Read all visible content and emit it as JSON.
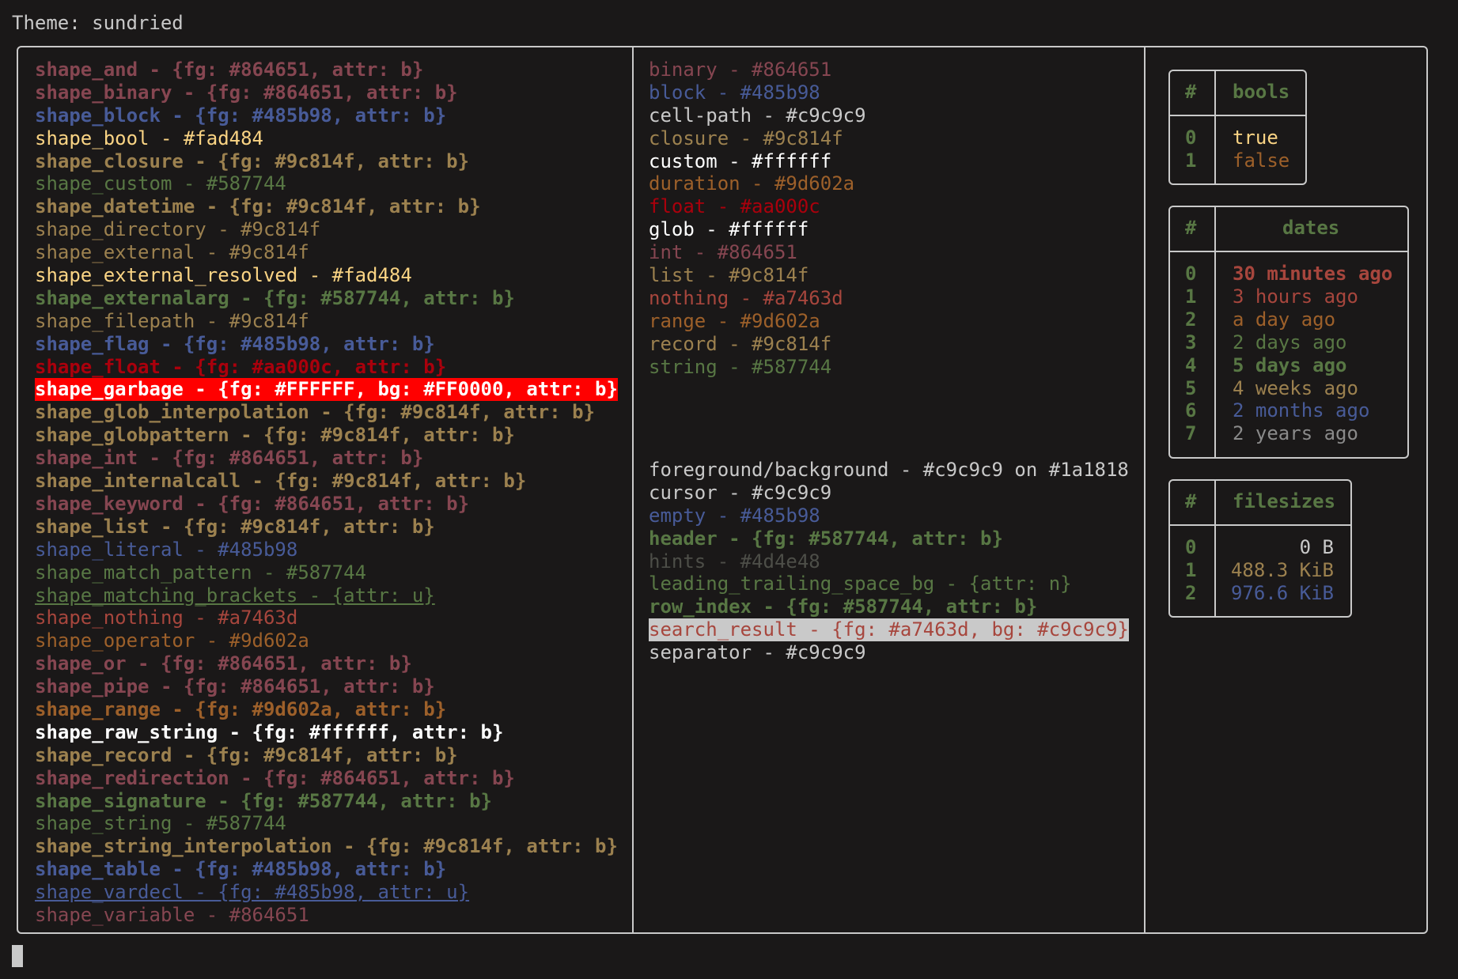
{
  "title": "Theme: sundried",
  "theme_name": "sundried",
  "colors": {
    "background": "#1a1818",
    "foreground": "#c9c9c9",
    "border": "#c9c9c9"
  },
  "shapes": [
    {
      "text": "shape_and - {fg: #864651, attr: b}",
      "fg": "#864651",
      "bold": true
    },
    {
      "text": "shape_binary - {fg: #864651, attr: b}",
      "fg": "#864651",
      "bold": true
    },
    {
      "text": "shape_block - {fg: #485b98, attr: b}",
      "fg": "#485b98",
      "bold": true
    },
    {
      "text": "shape_bool - #fad484",
      "fg": "#fad484"
    },
    {
      "text": "shape_closure - {fg: #9c814f, attr: b}",
      "fg": "#9c814f",
      "bold": true
    },
    {
      "text": "shape_custom - #587744",
      "fg": "#587744"
    },
    {
      "text": "shape_datetime - {fg: #9c814f, attr: b}",
      "fg": "#9c814f",
      "bold": true
    },
    {
      "text": "shape_directory - #9c814f",
      "fg": "#9c814f"
    },
    {
      "text": "shape_external - #9c814f",
      "fg": "#9c814f"
    },
    {
      "text": "shape_external_resolved - #fad484",
      "fg": "#fad484"
    },
    {
      "text": "shape_externalarg - {fg: #587744, attr: b}",
      "fg": "#587744",
      "bold": true
    },
    {
      "text": "shape_filepath - #9c814f",
      "fg": "#9c814f"
    },
    {
      "text": "shape_flag - {fg: #485b98, attr: b}",
      "fg": "#485b98",
      "bold": true
    },
    {
      "text": "shape_float - {fg: #aa000c, attr: b}",
      "fg": "#aa000c",
      "bold": true
    },
    {
      "text": "shape_garbage - {fg: #FFFFFF, bg: #FF0000, attr: b}",
      "fg": "#FFFFFF",
      "bg": "#FF0000",
      "bold": true
    },
    {
      "text": "shape_glob_interpolation - {fg: #9c814f, attr: b}",
      "fg": "#9c814f",
      "bold": true
    },
    {
      "text": "shape_globpattern - {fg: #9c814f, attr: b}",
      "fg": "#9c814f",
      "bold": true
    },
    {
      "text": "shape_int - {fg: #864651, attr: b}",
      "fg": "#864651",
      "bold": true
    },
    {
      "text": "shape_internalcall - {fg: #9c814f, attr: b}",
      "fg": "#9c814f",
      "bold": true
    },
    {
      "text": "shape_keyword - {fg: #864651, attr: b}",
      "fg": "#864651",
      "bold": true
    },
    {
      "text": "shape_list - {fg: #9c814f, attr: b}",
      "fg": "#9c814f",
      "bold": true
    },
    {
      "text": "shape_literal - #485b98",
      "fg": "#485b98"
    },
    {
      "text": "shape_match_pattern - #587744",
      "fg": "#587744"
    },
    {
      "text": "shape_matching_brackets - {attr: u}",
      "fg": "#587744",
      "underline": true
    },
    {
      "text": "shape_nothing - #a7463d",
      "fg": "#a7463d"
    },
    {
      "text": "shape_operator - #9d602a",
      "fg": "#9d602a"
    },
    {
      "text": "shape_or - {fg: #864651, attr: b}",
      "fg": "#864651",
      "bold": true
    },
    {
      "text": "shape_pipe - {fg: #864651, attr: b}",
      "fg": "#864651",
      "bold": true
    },
    {
      "text": "shape_range - {fg: #9d602a, attr: b}",
      "fg": "#9d602a",
      "bold": true
    },
    {
      "text": "shape_raw_string - {fg: #ffffff, attr: b}",
      "fg": "#ffffff",
      "bold": true
    },
    {
      "text": "shape_record - {fg: #9c814f, attr: b}",
      "fg": "#9c814f",
      "bold": true
    },
    {
      "text": "shape_redirection - {fg: #864651, attr: b}",
      "fg": "#864651",
      "bold": true
    },
    {
      "text": "shape_signature - {fg: #587744, attr: b}",
      "fg": "#587744",
      "bold": true
    },
    {
      "text": "shape_string - #587744",
      "fg": "#587744"
    },
    {
      "text": "shape_string_interpolation - {fg: #9c814f, attr: b}",
      "fg": "#9c814f",
      "bold": true
    },
    {
      "text": "shape_table - {fg: #485b98, attr: b}",
      "fg": "#485b98",
      "bold": true
    },
    {
      "text": "shape_vardecl - {fg: #485b98, attr: u}",
      "fg": "#485b98",
      "underline": true
    },
    {
      "text": "shape_variable - #864651",
      "fg": "#864651"
    }
  ],
  "types": [
    {
      "text": "binary - #864651",
      "fg": "#864651"
    },
    {
      "text": "block - #485b98",
      "fg": "#485b98"
    },
    {
      "text": "cell-path - #c9c9c9",
      "fg": "#c9c9c9"
    },
    {
      "text": "closure - #9c814f",
      "fg": "#9c814f"
    },
    {
      "text": "custom - #ffffff",
      "fg": "#ffffff"
    },
    {
      "text": "duration - #9d602a",
      "fg": "#9d602a"
    },
    {
      "text": "float - #aa000c",
      "fg": "#aa000c"
    },
    {
      "text": "glob - #ffffff",
      "fg": "#ffffff"
    },
    {
      "text": "int - #864651",
      "fg": "#864651"
    },
    {
      "text": "list - #9c814f",
      "fg": "#9c814f"
    },
    {
      "text": "nothing - #a7463d",
      "fg": "#a7463d"
    },
    {
      "text": "range - #9d602a",
      "fg": "#9d602a"
    },
    {
      "text": "record - #9c814f",
      "fg": "#9c814f"
    },
    {
      "text": "string - #587744",
      "fg": "#587744"
    }
  ],
  "ui": [
    {
      "text": "foreground/background - #c9c9c9 on #1a1818",
      "fg": "#c9c9c9"
    },
    {
      "text": "cursor - #c9c9c9",
      "fg": "#c9c9c9"
    },
    {
      "text": "empty - #485b98",
      "fg": "#485b98"
    },
    {
      "text": "header - {fg: #587744, attr: b}",
      "fg": "#587744",
      "bold": true
    },
    {
      "text": "hints - #4d4e48",
      "fg": "#4d4e48"
    },
    {
      "text": "leading_trailing_space_bg - {attr: n}",
      "fg": "#587744"
    },
    {
      "text": "row_index - {fg: #587744, attr: b}",
      "fg": "#587744",
      "bold": true
    },
    {
      "text": "search_result - {fg: #a7463d, bg: #c9c9c9}",
      "fg": "#a7463d",
      "bg": "#c9c9c9"
    },
    {
      "text": "separator - #c9c9c9",
      "fg": "#c9c9c9"
    }
  ],
  "tables": {
    "bools": {
      "index_header": "#",
      "header": "bools",
      "rows": [
        {
          "index": "0",
          "value": "true",
          "fg": "#fad484"
        },
        {
          "index": "1",
          "value": "false",
          "fg": "#9d602a"
        }
      ]
    },
    "dates": {
      "index_header": "#",
      "header": "dates",
      "rows": [
        {
          "index": "0",
          "value": "30 minutes ago",
          "fg": "#a7463d",
          "bold": true
        },
        {
          "index": "1",
          "value": "3 hours ago",
          "fg": "#a7463d"
        },
        {
          "index": "2",
          "value": "a day ago",
          "fg": "#9d602a"
        },
        {
          "index": "3",
          "value": "2 days ago",
          "fg": "#587744"
        },
        {
          "index": "4",
          "value": "5 days ago",
          "fg": "#587744",
          "bold": true
        },
        {
          "index": "5",
          "value": "4 weeks ago",
          "fg": "#9c814f"
        },
        {
          "index": "6",
          "value": "2 months ago",
          "fg": "#485b98"
        },
        {
          "index": "7",
          "value": "2 years ago",
          "fg": "#8a8a8a"
        }
      ]
    },
    "filesizes": {
      "index_header": "#",
      "header": "filesizes",
      "rows": [
        {
          "index": "0",
          "value": "0 B",
          "fg": "#c9c9c9"
        },
        {
          "index": "1",
          "value": "488.3 KiB",
          "fg": "#9c814f"
        },
        {
          "index": "2",
          "value": "976.6 KiB",
          "fg": "#485b98"
        }
      ]
    }
  }
}
